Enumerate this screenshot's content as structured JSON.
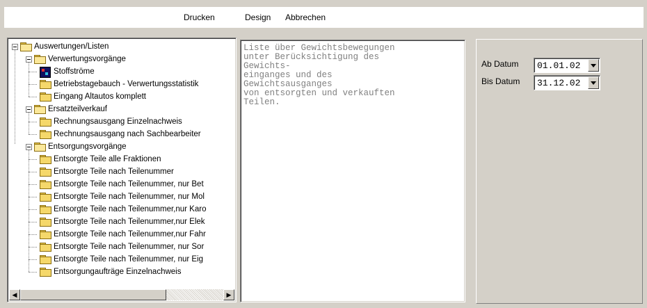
{
  "toolbar": {
    "print_label": "Drucken",
    "design_label": "Design",
    "cancel_label": "Abbrechen"
  },
  "tree": {
    "root": "Auswertungen/Listen",
    "groups": [
      {
        "label": "Verwertungsvorgänge",
        "items": [
          {
            "label": "Stoffströme",
            "icon": "flow-chart-icon"
          },
          {
            "label": "Betriebstagebauch - Verwertungsstatistik",
            "icon": "folder-icon"
          },
          {
            "label": "Eingang Altautos komplett",
            "icon": "folder-icon"
          }
        ]
      },
      {
        "label": "Ersatzteilverkauf",
        "items": [
          {
            "label": "Rechnungsausgang Einzelnachweis",
            "icon": "folder-icon"
          },
          {
            "label": "Rechnungsausgang nach Sachbearbeiter",
            "icon": "folder-icon"
          }
        ]
      },
      {
        "label": "Entsorgungsvorgänge",
        "items": [
          {
            "label": "Entsorgte Teile alle Fraktionen",
            "icon": "folder-icon"
          },
          {
            "label": "Entsorgte Teile nach Teilenummer",
            "icon": "folder-icon"
          },
          {
            "label": "Entsorgte Teile nach Teilenummer, nur Bet",
            "icon": "folder-icon"
          },
          {
            "label": "Entsorgte Teile nach Teilenummer, nur Mol",
            "icon": "folder-icon"
          },
          {
            "label": "Entsorgte Teile nach Teilenummer,nur Karo",
            "icon": "folder-icon"
          },
          {
            "label": "Entsorgte Teile nach Teilenummer,nur Elek",
            "icon": "folder-icon"
          },
          {
            "label": "Entsorgte Teile nach Teilenummer,nur Fahr",
            "icon": "folder-icon"
          },
          {
            "label": "Entsorgte Teile nach Teilenummer, nur Sor",
            "icon": "folder-icon"
          },
          {
            "label": "Entsorgte Teile nach Teilenummer, nur Eig",
            "icon": "folder-icon"
          },
          {
            "label": "Entsorgungaufträge Einzelnachweis",
            "icon": "folder-icon"
          }
        ]
      }
    ]
  },
  "description": "Liste über Gewichtsbewegungen\nunter Berücksichtigung des\nGewichts-\neinganges und des\nGewichtsausganges\nvon entsorgten und verkauften\nTeilen.",
  "filters": {
    "from_label": "Ab Datum",
    "from_value": "01.01.02",
    "to_label": "Bis Datum",
    "to_value": "31.12.02"
  },
  "colors": {
    "window_bg": "#d4d0c8",
    "description_text": "#808080",
    "folder": "#f5d86a"
  }
}
